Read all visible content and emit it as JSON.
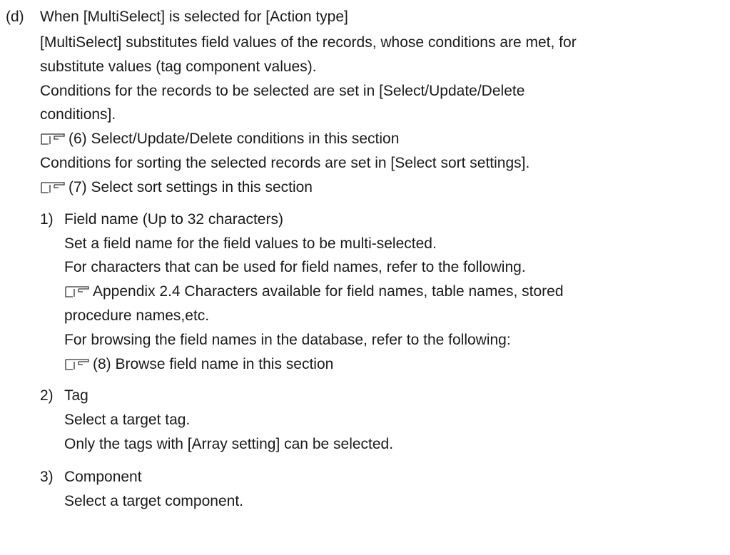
{
  "heading": {
    "marker": "(d)",
    "text": "When [MultiSelect] is selected for [Action type]"
  },
  "intro": [
    "[MultiSelect] substitutes field values of the records, whose conditions are met, for",
    "substitute values (tag component values).",
    "Conditions for the records to be selected are set in [Select/Update/Delete",
    "conditions]."
  ],
  "ref1": "(6) Select/Update/Delete conditions in this section",
  "sort_line": "Conditions for sorting the selected records are set in [Select sort settings].",
  "ref2": "(7) Select sort settings in this section",
  "items": [
    {
      "marker": "1)",
      "title": "Field name (Up to 32 characters)",
      "lines": [
        "Set a field name for the field values to be multi-selected.",
        "For characters that can be used for field names, refer to the following."
      ],
      "ref_a_line1": "Appendix 2.4 Characters available for field names, table names, stored",
      "ref_a_line2": "procedure names,etc.",
      "line_after": "For browsing the field names in the database, refer to the following:",
      "ref_b": "(8) Browse field name in this section"
    },
    {
      "marker": "2)",
      "title": "Tag",
      "lines": [
        "Select a target tag.",
        "Only the tags with [Array setting] can be selected."
      ]
    },
    {
      "marker": "3)",
      "title": "Component",
      "lines": [
        "Select a target component."
      ]
    }
  ]
}
